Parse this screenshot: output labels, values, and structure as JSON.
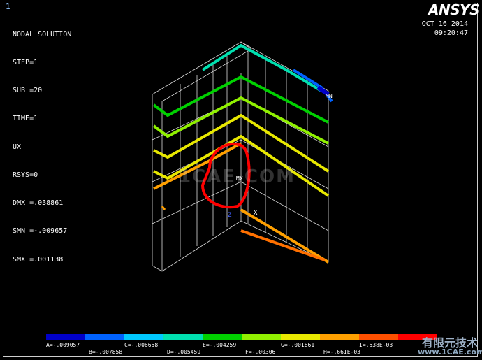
{
  "window_number": "1",
  "title": "NODAL SOLUTION",
  "info": [
    "STEP=1",
    "SUB =20",
    "TIME=1",
    "UX",
    "RSYS=0",
    "DMX =.038861",
    "SMN =-.009657",
    "SMX =.001138"
  ],
  "brand": "ANSYS",
  "date": "OCT 16 2014",
  "time": "09:20:47",
  "markers": {
    "mn": "MN",
    "mx": "MX",
    "z": "Z",
    "x": "X"
  },
  "watermark": "1CAE.COM",
  "watermark2": "有限元技术",
  "watermark3": "www.1CAE.com",
  "legend": {
    "colors": [
      "#0000c8",
      "#0062ff",
      "#00c8ff",
      "#00e0b0",
      "#00d000",
      "#90f000",
      "#e8e800",
      "#ffa000",
      "#ff5000",
      "#ff0000"
    ],
    "top_labels": [
      "A=-.009057",
      "C=-.006658",
      "E=-.004259",
      "G=-.001861",
      "I=.538E-03"
    ],
    "bottom_labels": [
      "B=-.007858",
      "D=-.005459",
      "F=-.00306",
      "H=-.661E-03"
    ]
  }
}
